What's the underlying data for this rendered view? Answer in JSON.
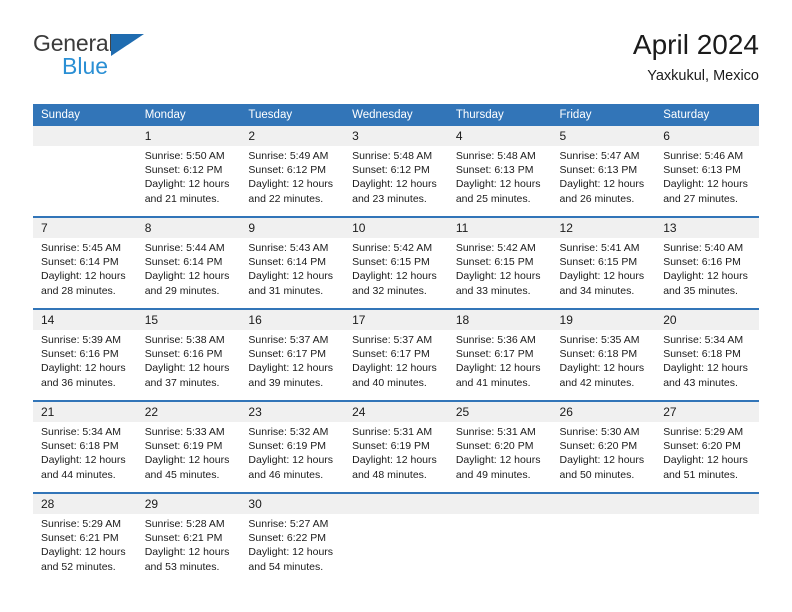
{
  "brand": {
    "name_part1": "General",
    "name_part2": "Blue",
    "triangle_color": "#1f6cb0",
    "blue_color": "#2a8fd4"
  },
  "header": {
    "title": "April 2024",
    "subtitle": "Yaxkukul, Mexico"
  },
  "theme": {
    "header_blue": "#3275b8",
    "daynum_band": "#f0f0f0",
    "text": "#1b1b1b"
  },
  "calendar": {
    "day_headers": [
      "Sunday",
      "Monday",
      "Tuesday",
      "Wednesday",
      "Thursday",
      "Friday",
      "Saturday"
    ],
    "weeks": [
      [
        {
          "day": "",
          "sunrise": "",
          "sunset": "",
          "daylight": ""
        },
        {
          "day": "1",
          "sunrise": "Sunrise: 5:50 AM",
          "sunset": "Sunset: 6:12 PM",
          "daylight": "Daylight: 12 hours and 21 minutes."
        },
        {
          "day": "2",
          "sunrise": "Sunrise: 5:49 AM",
          "sunset": "Sunset: 6:12 PM",
          "daylight": "Daylight: 12 hours and 22 minutes."
        },
        {
          "day": "3",
          "sunrise": "Sunrise: 5:48 AM",
          "sunset": "Sunset: 6:12 PM",
          "daylight": "Daylight: 12 hours and 23 minutes."
        },
        {
          "day": "4",
          "sunrise": "Sunrise: 5:48 AM",
          "sunset": "Sunset: 6:13 PM",
          "daylight": "Daylight: 12 hours and 25 minutes."
        },
        {
          "day": "5",
          "sunrise": "Sunrise: 5:47 AM",
          "sunset": "Sunset: 6:13 PM",
          "daylight": "Daylight: 12 hours and 26 minutes."
        },
        {
          "day": "6",
          "sunrise": "Sunrise: 5:46 AM",
          "sunset": "Sunset: 6:13 PM",
          "daylight": "Daylight: 12 hours and 27 minutes."
        }
      ],
      [
        {
          "day": "7",
          "sunrise": "Sunrise: 5:45 AM",
          "sunset": "Sunset: 6:14 PM",
          "daylight": "Daylight: 12 hours and 28 minutes."
        },
        {
          "day": "8",
          "sunrise": "Sunrise: 5:44 AM",
          "sunset": "Sunset: 6:14 PM",
          "daylight": "Daylight: 12 hours and 29 minutes."
        },
        {
          "day": "9",
          "sunrise": "Sunrise: 5:43 AM",
          "sunset": "Sunset: 6:14 PM",
          "daylight": "Daylight: 12 hours and 31 minutes."
        },
        {
          "day": "10",
          "sunrise": "Sunrise: 5:42 AM",
          "sunset": "Sunset: 6:15 PM",
          "daylight": "Daylight: 12 hours and 32 minutes."
        },
        {
          "day": "11",
          "sunrise": "Sunrise: 5:42 AM",
          "sunset": "Sunset: 6:15 PM",
          "daylight": "Daylight: 12 hours and 33 minutes."
        },
        {
          "day": "12",
          "sunrise": "Sunrise: 5:41 AM",
          "sunset": "Sunset: 6:15 PM",
          "daylight": "Daylight: 12 hours and 34 minutes."
        },
        {
          "day": "13",
          "sunrise": "Sunrise: 5:40 AM",
          "sunset": "Sunset: 6:16 PM",
          "daylight": "Daylight: 12 hours and 35 minutes."
        }
      ],
      [
        {
          "day": "14",
          "sunrise": "Sunrise: 5:39 AM",
          "sunset": "Sunset: 6:16 PM",
          "daylight": "Daylight: 12 hours and 36 minutes."
        },
        {
          "day": "15",
          "sunrise": "Sunrise: 5:38 AM",
          "sunset": "Sunset: 6:16 PM",
          "daylight": "Daylight: 12 hours and 37 minutes."
        },
        {
          "day": "16",
          "sunrise": "Sunrise: 5:37 AM",
          "sunset": "Sunset: 6:17 PM",
          "daylight": "Daylight: 12 hours and 39 minutes."
        },
        {
          "day": "17",
          "sunrise": "Sunrise: 5:37 AM",
          "sunset": "Sunset: 6:17 PM",
          "daylight": "Daylight: 12 hours and 40 minutes."
        },
        {
          "day": "18",
          "sunrise": "Sunrise: 5:36 AM",
          "sunset": "Sunset: 6:17 PM",
          "daylight": "Daylight: 12 hours and 41 minutes."
        },
        {
          "day": "19",
          "sunrise": "Sunrise: 5:35 AM",
          "sunset": "Sunset: 6:18 PM",
          "daylight": "Daylight: 12 hours and 42 minutes."
        },
        {
          "day": "20",
          "sunrise": "Sunrise: 5:34 AM",
          "sunset": "Sunset: 6:18 PM",
          "daylight": "Daylight: 12 hours and 43 minutes."
        }
      ],
      [
        {
          "day": "21",
          "sunrise": "Sunrise: 5:34 AM",
          "sunset": "Sunset: 6:18 PM",
          "daylight": "Daylight: 12 hours and 44 minutes."
        },
        {
          "day": "22",
          "sunrise": "Sunrise: 5:33 AM",
          "sunset": "Sunset: 6:19 PM",
          "daylight": "Daylight: 12 hours and 45 minutes."
        },
        {
          "day": "23",
          "sunrise": "Sunrise: 5:32 AM",
          "sunset": "Sunset: 6:19 PM",
          "daylight": "Daylight: 12 hours and 46 minutes."
        },
        {
          "day": "24",
          "sunrise": "Sunrise: 5:31 AM",
          "sunset": "Sunset: 6:19 PM",
          "daylight": "Daylight: 12 hours and 48 minutes."
        },
        {
          "day": "25",
          "sunrise": "Sunrise: 5:31 AM",
          "sunset": "Sunset: 6:20 PM",
          "daylight": "Daylight: 12 hours and 49 minutes."
        },
        {
          "day": "26",
          "sunrise": "Sunrise: 5:30 AM",
          "sunset": "Sunset: 6:20 PM",
          "daylight": "Daylight: 12 hours and 50 minutes."
        },
        {
          "day": "27",
          "sunrise": "Sunrise: 5:29 AM",
          "sunset": "Sunset: 6:20 PM",
          "daylight": "Daylight: 12 hours and 51 minutes."
        }
      ],
      [
        {
          "day": "28",
          "sunrise": "Sunrise: 5:29 AM",
          "sunset": "Sunset: 6:21 PM",
          "daylight": "Daylight: 12 hours and 52 minutes."
        },
        {
          "day": "29",
          "sunrise": "Sunrise: 5:28 AM",
          "sunset": "Sunset: 6:21 PM",
          "daylight": "Daylight: 12 hours and 53 minutes."
        },
        {
          "day": "30",
          "sunrise": "Sunrise: 5:27 AM",
          "sunset": "Sunset: 6:22 PM",
          "daylight": "Daylight: 12 hours and 54 minutes."
        },
        {
          "day": "",
          "sunrise": "",
          "sunset": "",
          "daylight": ""
        },
        {
          "day": "",
          "sunrise": "",
          "sunset": "",
          "daylight": ""
        },
        {
          "day": "",
          "sunrise": "",
          "sunset": "",
          "daylight": ""
        },
        {
          "day": "",
          "sunrise": "",
          "sunset": "",
          "daylight": ""
        }
      ]
    ]
  }
}
